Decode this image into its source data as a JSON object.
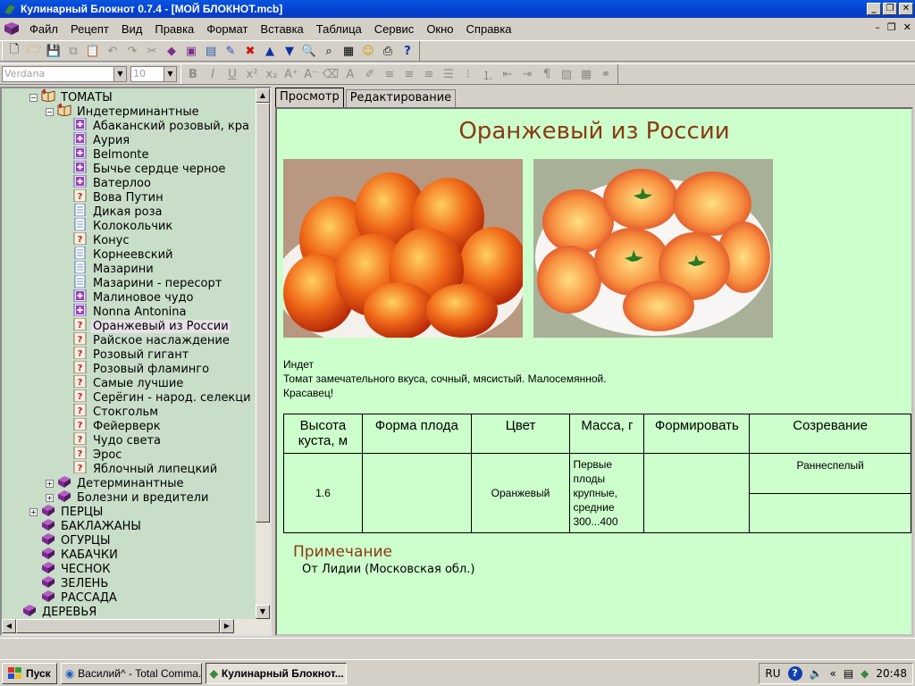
{
  "window": {
    "title": "Кулинарный Блокнот 0.7.4 - [МОЙ БЛОКНОТ.mcb]"
  },
  "menu": [
    "Файл",
    "Рецепт",
    "Вид",
    "Правка",
    "Формат",
    "Вставка",
    "Таблица",
    "Сервис",
    "Окно",
    "Справка"
  ],
  "format_toolbar": {
    "font": "Verdana",
    "size": "10"
  },
  "tree": {
    "items": [
      {
        "label": "ТОМАТЫ",
        "level": 2,
        "expander": "−",
        "icon": "book-open-icon"
      },
      {
        "label": "Индетерминантные",
        "level": 3,
        "expander": "−",
        "icon": "book-open-icon"
      },
      {
        "label": "Абаканский розовый, кра",
        "level": 4,
        "icon": "recipe-plus-icon"
      },
      {
        "label": "Аурия",
        "level": 4,
        "icon": "recipe-plus-icon"
      },
      {
        "label": "Belmonte",
        "level": 4,
        "icon": "recipe-plus-icon"
      },
      {
        "label": "Бычье сердце черное",
        "level": 4,
        "icon": "recipe-plus-icon"
      },
      {
        "label": "Ватерлоо",
        "level": 4,
        "icon": "recipe-plus-icon"
      },
      {
        "label": "Вова Путин",
        "level": 4,
        "icon": "recipe-question-icon"
      },
      {
        "label": "Дикая роза",
        "level": 4,
        "icon": "page-icon"
      },
      {
        "label": "Колокольчик",
        "level": 4,
        "icon": "page-icon"
      },
      {
        "label": "Конус",
        "level": 4,
        "icon": "recipe-question-icon"
      },
      {
        "label": "Корнеевский",
        "level": 4,
        "icon": "page-icon"
      },
      {
        "label": "Мазарини",
        "level": 4,
        "icon": "page-icon"
      },
      {
        "label": "Мазарини - пересорт",
        "level": 4,
        "icon": "page-icon"
      },
      {
        "label": "Малиновое чудо",
        "level": 4,
        "icon": "recipe-plus-icon"
      },
      {
        "label": "Nonna Antonina",
        "level": 4,
        "icon": "recipe-plus-icon"
      },
      {
        "label": "Оранжевый из России",
        "level": 4,
        "icon": "recipe-question-icon",
        "selected": true
      },
      {
        "label": "Райское наслаждение",
        "level": 4,
        "icon": "recipe-question-icon"
      },
      {
        "label": "Розовый гигант",
        "level": 4,
        "icon": "recipe-question-icon"
      },
      {
        "label": "Розовый фламинго",
        "level": 4,
        "icon": "recipe-question-icon"
      },
      {
        "label": "Самые лучшие",
        "level": 4,
        "icon": "recipe-question-icon"
      },
      {
        "label": "Серёгин - народ. селекци",
        "level": 4,
        "icon": "recipe-question-icon"
      },
      {
        "label": "Стокгольм",
        "level": 4,
        "icon": "recipe-question-icon"
      },
      {
        "label": "Фейерверк",
        "level": 4,
        "icon": "recipe-question-icon"
      },
      {
        "label": "Чудо света",
        "level": 4,
        "icon": "recipe-question-icon"
      },
      {
        "label": "Эрос",
        "level": 4,
        "icon": "recipe-question-icon"
      },
      {
        "label": "Яблочный липецкий",
        "level": 4,
        "icon": "recipe-question-icon"
      },
      {
        "label": "Детерминантные",
        "level": 3,
        "expander": "+",
        "icon": "book-closed-icon"
      },
      {
        "label": "Болезни и вредители",
        "level": 3,
        "expander": "+",
        "icon": "book-closed-icon"
      },
      {
        "label": "ПЕРЦЫ",
        "level": 2,
        "expander": "+",
        "icon": "book-closed-icon"
      },
      {
        "label": "БАКЛАЖАНЫ",
        "level": 2,
        "icon": "book-closed-icon"
      },
      {
        "label": "ОГУРЦЫ",
        "level": 2,
        "icon": "book-closed-icon"
      },
      {
        "label": "КАБАЧКИ",
        "level": 2,
        "icon": "book-closed-icon"
      },
      {
        "label": "ЧЕСНОК",
        "level": 2,
        "icon": "book-closed-icon"
      },
      {
        "label": "ЗЕЛЕНЬ",
        "level": 2,
        "icon": "book-closed-icon"
      },
      {
        "label": "РАССАДА",
        "level": 2,
        "icon": "book-closed-icon"
      },
      {
        "label": "ДЕРЕВЬЯ",
        "level": 1,
        "icon": "book-closed-icon"
      }
    ]
  },
  "tabs": [
    {
      "label": "Просмотр",
      "active": true
    },
    {
      "label": "Редактирование",
      "active": false
    }
  ],
  "document": {
    "title": "Оранжевый из России",
    "description": [
      "Индет",
      "Томат замечательного вкуса, сочный, мясистый. Малосемянной.",
      "Красавец!"
    ],
    "table": {
      "headers": [
        "Высота куста, м",
        "Форма плода",
        "Цвет",
        "Масса, г",
        "Формировать",
        "Созревание"
      ],
      "height": "1.6",
      "shape": "",
      "color": "Оранжевый",
      "mass": "Первые плоды крупные, средние 300...400",
      "formation": "",
      "ripening": "Раннеспелый",
      "ripening_extra": ""
    },
    "note_title": "Примечание",
    "note_text": "От Лидии (Московская обл.)"
  },
  "taskbar": {
    "start": "Пуск",
    "tasks": [
      {
        "label": "Василий^ - Total Comma...",
        "active": false
      },
      {
        "label": "Кулинарный Блокнот...",
        "active": true
      }
    ],
    "lang": "RU",
    "time": "20:48"
  }
}
